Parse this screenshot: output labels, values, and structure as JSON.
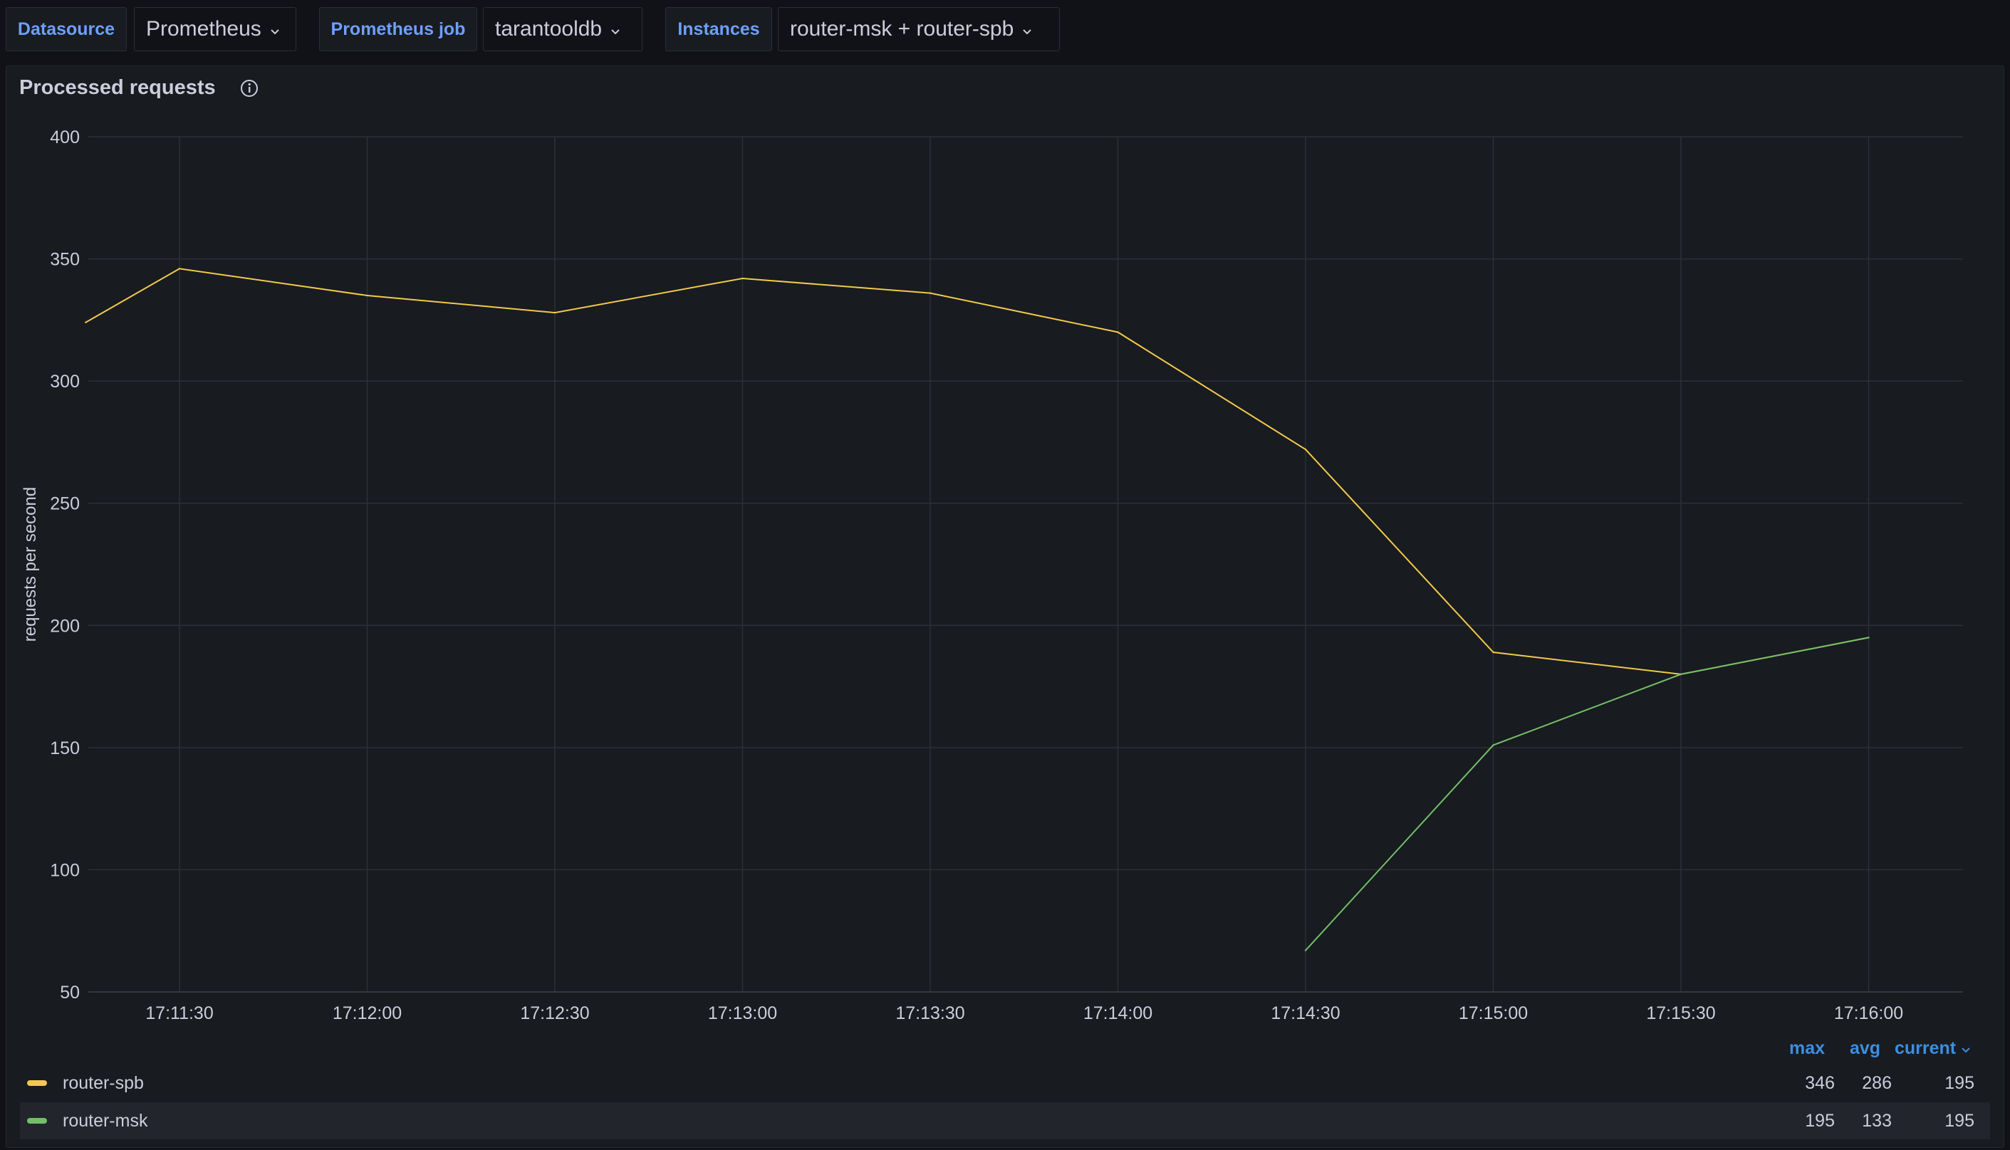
{
  "variables": [
    {
      "label": "Datasource",
      "value": "Prometheus"
    },
    {
      "label": "Prometheus job",
      "value": "tarantooldb"
    },
    {
      "label": "Instances",
      "value": "router-msk + router-spb"
    }
  ],
  "panel": {
    "title": "Processed requests"
  },
  "chart_data": {
    "type": "line",
    "ylabel": "requests per second",
    "ylim": [
      50,
      400
    ],
    "yticks": [
      "50",
      "100",
      "150",
      "200",
      "250",
      "300",
      "350",
      "400"
    ],
    "xticks": [
      "17:11:30",
      "17:12:00",
      "17:12:30",
      "17:13:00",
      "17:13:30",
      "17:14:00",
      "17:14:30",
      "17:15:00",
      "17:15:30",
      "17:16:00"
    ],
    "grid": true,
    "series": [
      {
        "name": "router-spb",
        "color": "#f2c94c",
        "points": [
          [
            "17:11:15",
            324
          ],
          [
            "17:11:30",
            346
          ],
          [
            "17:12:00",
            335
          ],
          [
            "17:12:30",
            328
          ],
          [
            "17:13:00",
            342
          ],
          [
            "17:13:30",
            336
          ],
          [
            "17:14:00",
            320
          ],
          [
            "17:14:30",
            272
          ],
          [
            "17:15:00",
            189
          ],
          [
            "17:15:30",
            180
          ],
          [
            "17:16:00",
            195
          ]
        ]
      },
      {
        "name": "router-msk",
        "color": "#73bf69",
        "points": [
          [
            "17:14:30",
            67
          ],
          [
            "17:15:00",
            151
          ],
          [
            "17:15:30",
            180
          ],
          [
            "17:16:00",
            195
          ]
        ]
      }
    ]
  },
  "legend": {
    "columns": [
      "max",
      "avg",
      "current"
    ],
    "rows": [
      {
        "name": "router-spb",
        "color": "#f2c94c",
        "max": "346",
        "avg": "286",
        "current": "195"
      },
      {
        "name": "router-msk",
        "color": "#73bf69",
        "max": "195",
        "avg": "133",
        "current": "195"
      }
    ]
  }
}
